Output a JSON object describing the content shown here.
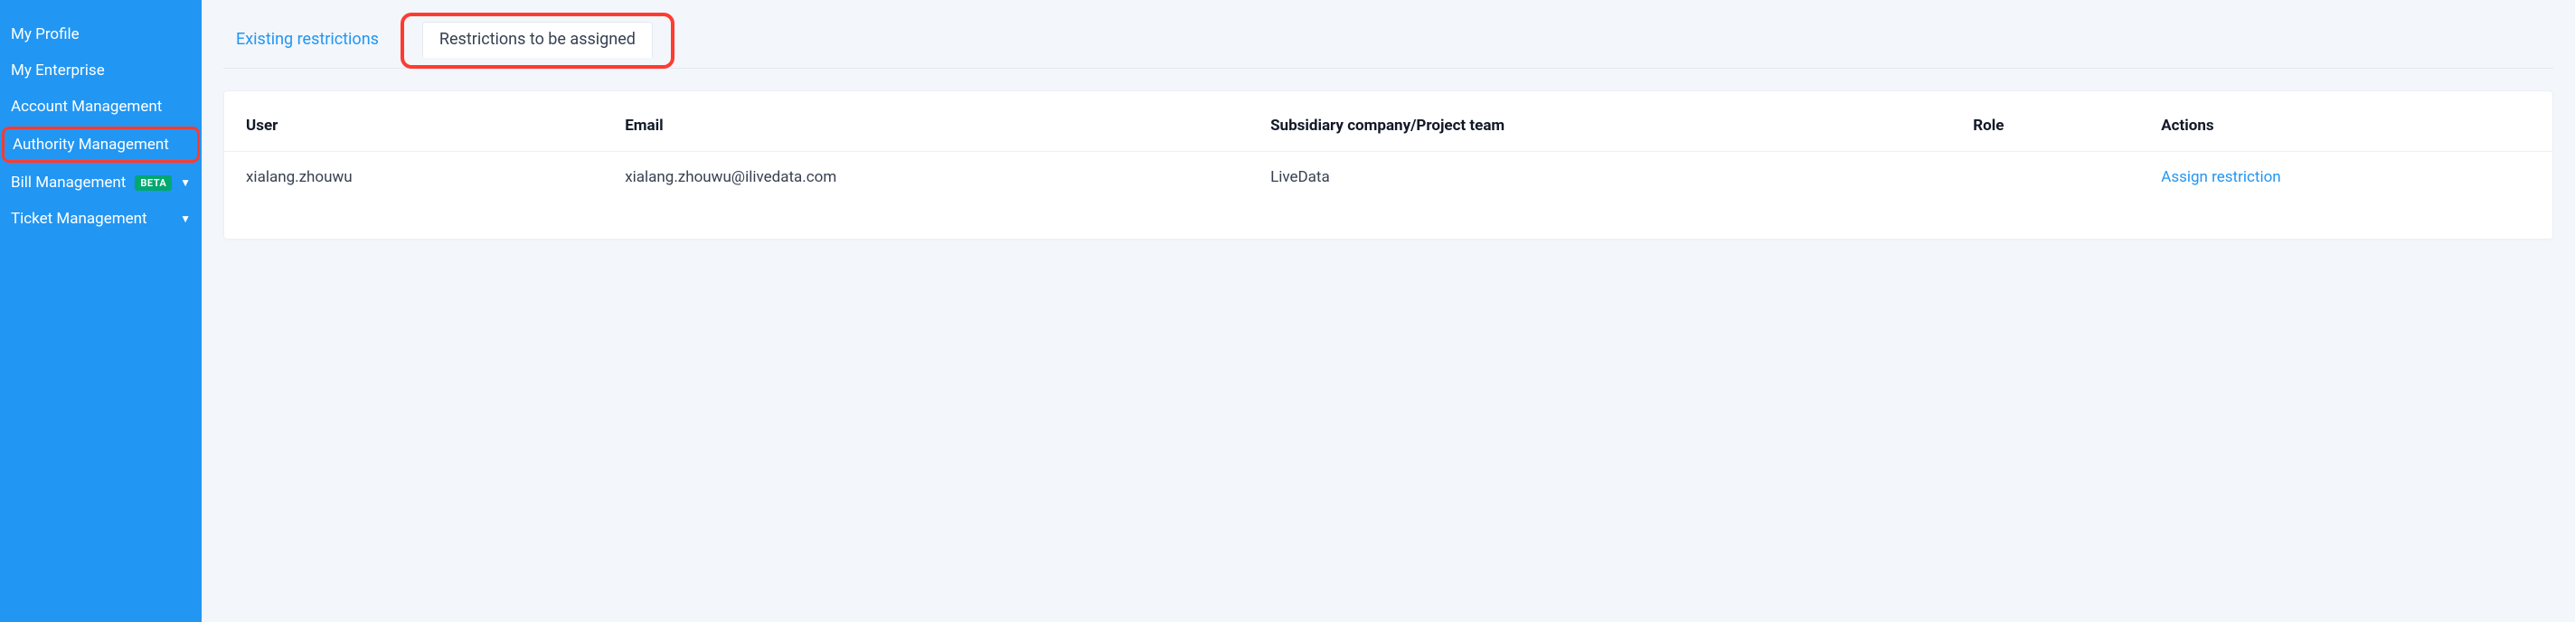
{
  "sidebar": {
    "items": [
      {
        "label": "My Profile",
        "badge": null,
        "expandable": false,
        "active": false
      },
      {
        "label": "My Enterprise",
        "badge": null,
        "expandable": false,
        "active": false
      },
      {
        "label": "Account Management",
        "badge": null,
        "expandable": false,
        "active": false
      },
      {
        "label": "Authority Management",
        "badge": null,
        "expandable": false,
        "active": true
      },
      {
        "label": "Bill Management",
        "badge": "BETA",
        "expandable": true,
        "active": false
      },
      {
        "label": "Ticket Management",
        "badge": null,
        "expandable": true,
        "active": false
      }
    ]
  },
  "tabs": {
    "existing": "Existing restrictions",
    "to_assign": "Restrictions to be assigned"
  },
  "table": {
    "headers": {
      "user": "User",
      "email": "Email",
      "subsidiary": "Subsidiary company/Project team",
      "role": "Role",
      "actions": "Actions"
    },
    "rows": [
      {
        "user": "xialang.zhouwu",
        "email": "xialang.zhouwu@ilivedata.com",
        "subsidiary": "LiveData",
        "role": "",
        "action_label": "Assign restriction"
      }
    ]
  }
}
